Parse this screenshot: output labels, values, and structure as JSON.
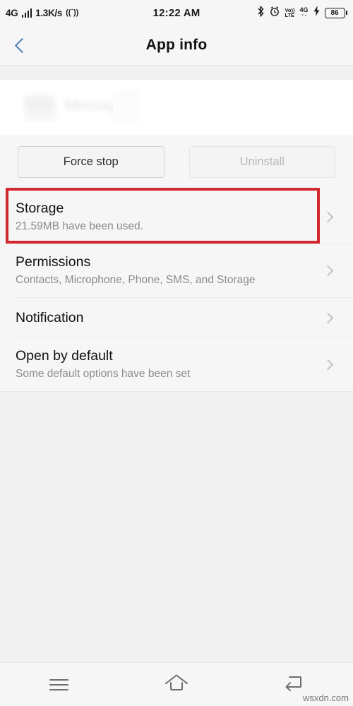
{
  "status_bar": {
    "network_type": "4G",
    "data_speed": "1.3K/s",
    "hotspot_icon": "hotspot-icon",
    "time": "12:22 AM",
    "bluetooth_icon": "bluetooth-icon",
    "alarm_icon": "alarm-icon",
    "volte_top": "Vo))",
    "volte_bottom": "LTE",
    "sim_network": "4G",
    "charging_icon": "charging-bolt-icon",
    "battery_level": "86"
  },
  "header": {
    "back_icon": "back-chevron-icon",
    "title": "App info"
  },
  "app_card": {
    "app_name": "Messages",
    "app_icon": "app-icon",
    "note": "redacted"
  },
  "actions": {
    "force_stop_label": "Force stop",
    "uninstall_label": "Uninstall"
  },
  "settings_rows": [
    {
      "title": "Storage",
      "subtitle": "21.59MB have been used.",
      "chevron": "chevron-right-icon",
      "highlighted": true
    },
    {
      "title": "Permissions",
      "subtitle": "Contacts, Microphone, Phone, SMS, and Storage",
      "chevron": "chevron-right-icon",
      "highlighted": false
    },
    {
      "title": "Notification",
      "subtitle": "",
      "chevron": "chevron-right-icon",
      "highlighted": false
    },
    {
      "title": "Open by default",
      "subtitle": "Some default options have been set",
      "chevron": "chevron-right-icon",
      "highlighted": false
    }
  ],
  "nav_bar": {
    "recents_icon": "menu-recents-icon",
    "home_icon": "home-icon",
    "back_icon": "back-arrow-icon"
  },
  "watermark": "wsxdn.com",
  "colors": {
    "highlight_red": "#d2282f",
    "back_chevron_blue": "#4a7fb5",
    "panel_bg": "#f6f6f6",
    "page_bg": "#f0f0f0"
  }
}
